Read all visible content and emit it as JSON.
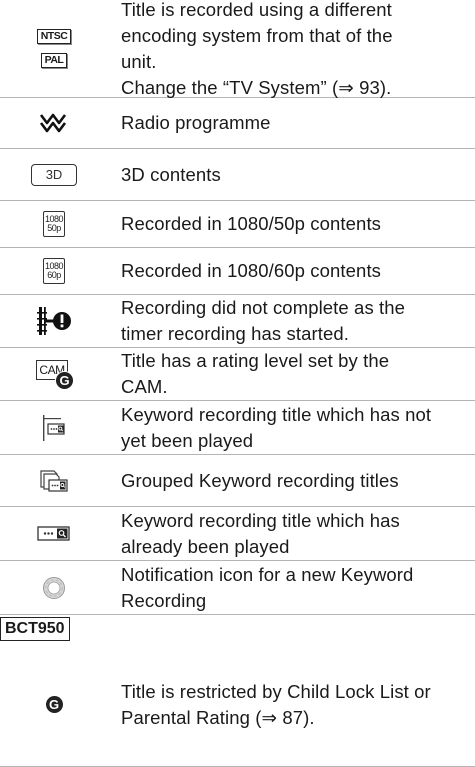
{
  "rows": [
    {
      "icons": [
        "NTSC",
        "PAL"
      ],
      "text": "Title is recorded using a different\nencoding system from that of the\nunit.\nChange the “TV System” (⇒ 93)."
    },
    {
      "icon": "radio-icon",
      "text": "Radio programme"
    },
    {
      "icon_label": "3D",
      "text": "3D contents"
    },
    {
      "icon_top": "1080",
      "icon_bottom": "50p",
      "text": "Recorded in 1080/50p contents"
    },
    {
      "icon_top": "1080",
      "icon_bottom": "60p",
      "text": "Recorded in 1080/60p contents"
    },
    {
      "icon": "recording-incomplete-icon",
      "text": "Recording did not complete as the\ntimer recording has started."
    },
    {
      "icon_label": "CAM",
      "icon_badge": "G",
      "text": "Title has a rating level set by the\nCAM."
    },
    {
      "icon": "keyword-unplayed-icon",
      "text": "Keyword recording title which has not\nyet been played"
    },
    {
      "icon": "keyword-group-icon",
      "text": "Grouped Keyword recording titles"
    },
    {
      "icon": "keyword-played-icon",
      "text": "Keyword recording title which has\nalready been played"
    },
    {
      "icon": "notification-ring-icon",
      "text": "Notification icon for a new Keyword\nRecording"
    }
  ],
  "model": {
    "label": "BCT950",
    "icon_badge": "G",
    "text": "Title is restricted by Child Lock List or\nParental Rating (⇒ 87)."
  }
}
